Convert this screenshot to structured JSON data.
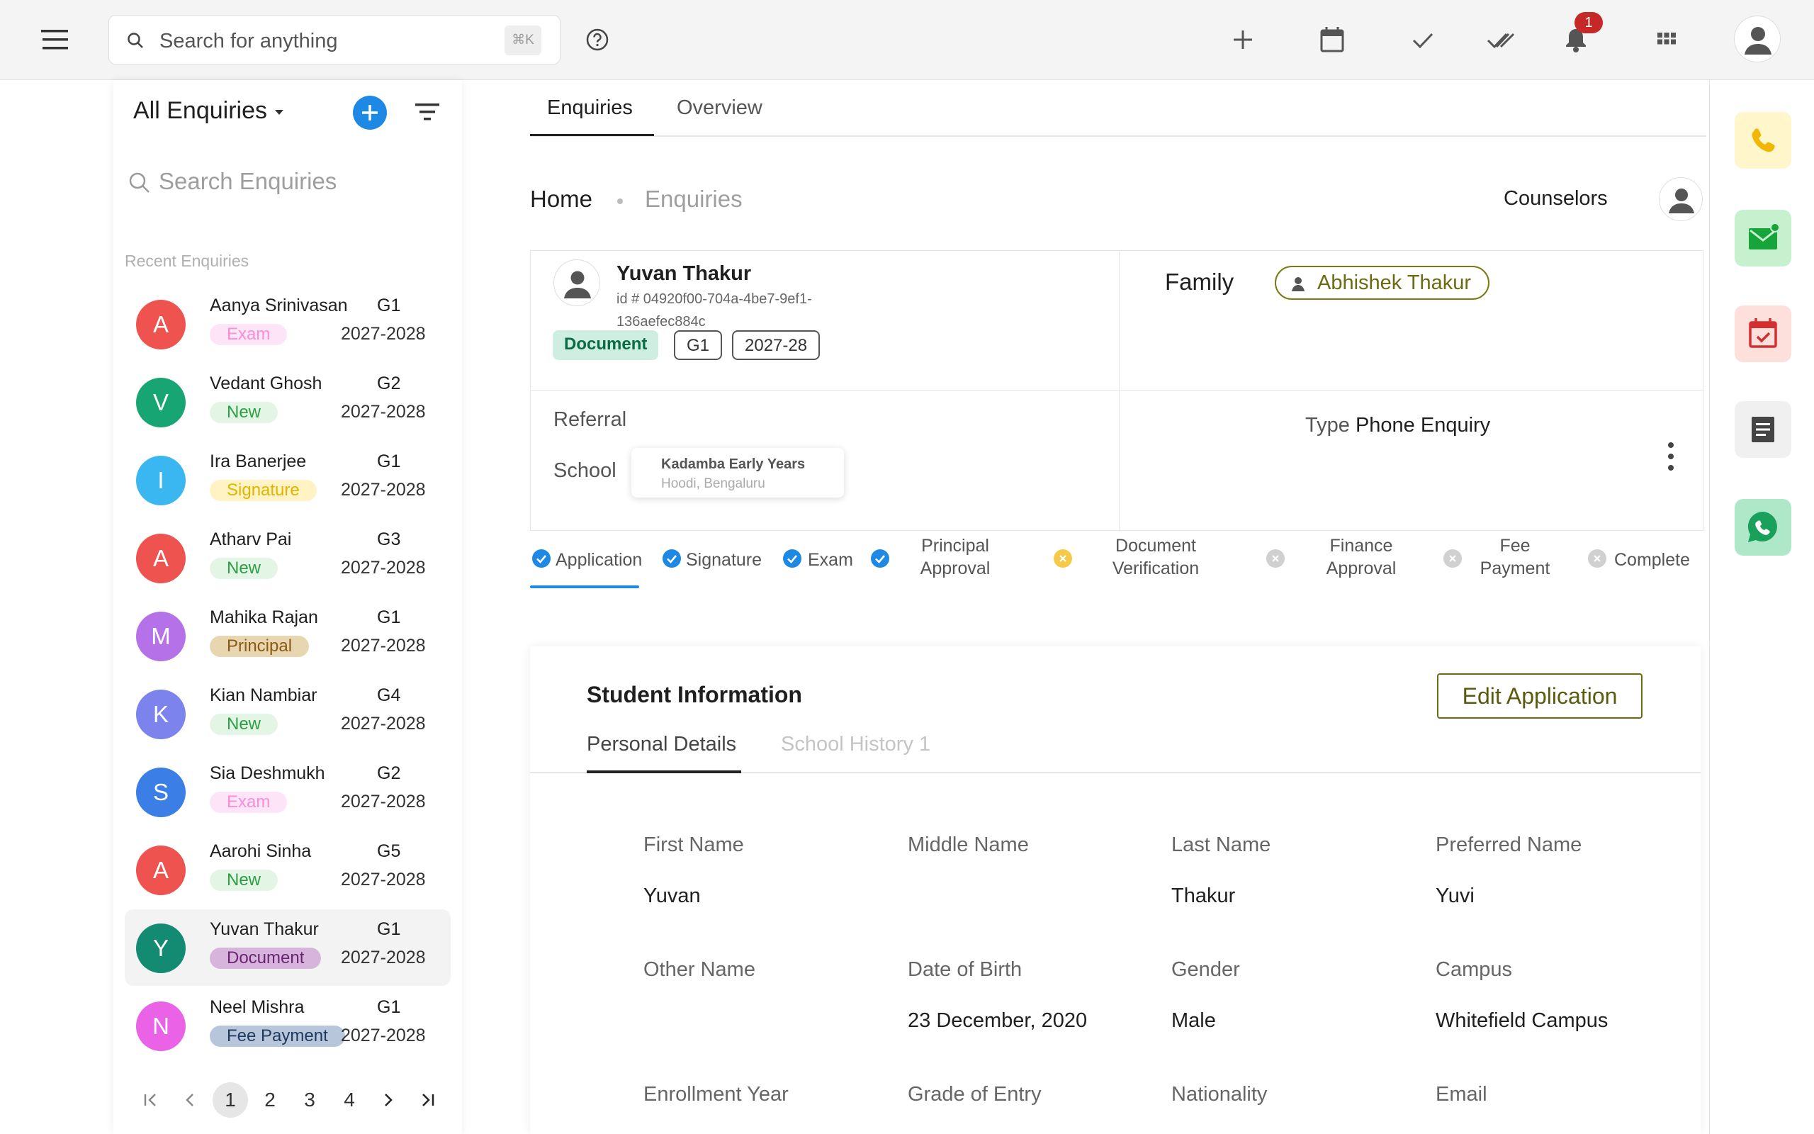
{
  "topbar": {
    "search_placeholder": "Search for anything",
    "search_shortcut": "⌘K",
    "notification_count": "1",
    "icons": [
      "menu-icon",
      "search-icon",
      "help-icon",
      "plus-icon",
      "calendar-icon",
      "check-icon",
      "double-check-icon",
      "bell-icon",
      "apps-grid-icon",
      "user-avatar-icon"
    ]
  },
  "sidebar": {
    "title": "All Enquiries",
    "search_placeholder": "Search Enquiries",
    "recent_label": "Recent Enquiries",
    "items": [
      {
        "initial": "A",
        "name": "Aanya Srinivasan",
        "grade": "G1",
        "status": "Exam",
        "year": "2027-2028",
        "avatar_color": "#ef5350",
        "tag_bg": "#fde4f6",
        "tag_fg": "#f48fd8"
      },
      {
        "initial": "V",
        "name": "Vedant Ghosh",
        "grade": "G2",
        "status": "New",
        "year": "2027-2028",
        "avatar_color": "#17a673",
        "tag_bg": "#e3f6e6",
        "tag_fg": "#2e9e45"
      },
      {
        "initial": "I",
        "name": "Ira Banerjee",
        "grade": "G1",
        "status": "Signature",
        "year": "2027-2028",
        "avatar_color": "#3ab7f0",
        "tag_bg": "#fff3c4",
        "tag_fg": "#e0b400"
      },
      {
        "initial": "A",
        "name": "Atharv Pai",
        "grade": "G3",
        "status": "New",
        "year": "2027-2028",
        "avatar_color": "#ef5350",
        "tag_bg": "#e3f6e6",
        "tag_fg": "#2e9e45"
      },
      {
        "initial": "M",
        "name": "Mahika Rajan",
        "grade": "G1",
        "status": "Principal",
        "year": "2027-2028",
        "avatar_color": "#b572e8",
        "tag_bg": "#e8d6b0",
        "tag_fg": "#8a5a14"
      },
      {
        "initial": "K",
        "name": "Kian Nambiar",
        "grade": "G4",
        "status": "New",
        "year": "2027-2028",
        "avatar_color": "#7c83ec",
        "tag_bg": "#e3f6e6",
        "tag_fg": "#2e9e45"
      },
      {
        "initial": "S",
        "name": "Sia Deshmukh",
        "grade": "G2",
        "status": "Exam",
        "year": "2027-2028",
        "avatar_color": "#3a7ee6",
        "tag_bg": "#fde4f6",
        "tag_fg": "#f48fd8"
      },
      {
        "initial": "A",
        "name": "Aarohi Sinha",
        "grade": "G5",
        "status": "New",
        "year": "2027-2028",
        "avatar_color": "#ef5350",
        "tag_bg": "#e3f6e6",
        "tag_fg": "#2e9e45"
      },
      {
        "initial": "Y",
        "name": "Yuvan Thakur",
        "grade": "G1",
        "status": "Document",
        "year": "2027-2028",
        "avatar_color": "#138a72",
        "tag_bg": "#d7b4dc",
        "tag_fg": "#6b2474"
      },
      {
        "initial": "N",
        "name": "Neel Mishra",
        "grade": "G1",
        "status": "Fee Payment",
        "year": "2027-2028",
        "avatar_color": "#ea62e6",
        "tag_bg": "#b7c6da",
        "tag_fg": "#1d3a5e"
      }
    ],
    "pagination": [
      "1",
      "2",
      "3",
      "4"
    ],
    "current_page": "1"
  },
  "main": {
    "tabs": [
      "Enquiries",
      "Overview"
    ],
    "breadcrumb": {
      "home": "Home",
      "current": "Enquiries"
    },
    "counselors_label": "Counselors",
    "student": {
      "name": "Yuvan Thakur",
      "id": "id # 04920f00-704a-4be7-9ef1-136aefec884c",
      "chips": [
        "Document",
        "G1",
        "2027-28"
      ]
    },
    "family": {
      "label": "Family",
      "member": "Abhishek Thakur"
    },
    "referral_label": "Referral",
    "school_label": "School",
    "school": {
      "name": "Kadamba Early Years",
      "location": "Hoodi, Bengaluru"
    },
    "type": {
      "label": "Type",
      "value": "Phone Enquiry"
    },
    "steps": [
      {
        "label": "Application",
        "state": "done"
      },
      {
        "label": "Signature",
        "state": "done"
      },
      {
        "label": "Exam",
        "state": "done"
      },
      {
        "label": "Principal Approval",
        "state": "done"
      },
      {
        "label": "Document Verification",
        "state": "current"
      },
      {
        "label": "Finance Approval",
        "state": "pending"
      },
      {
        "label": "Fee Payment",
        "state": "pending"
      },
      {
        "label": "Complete",
        "state": "pending"
      }
    ],
    "info": {
      "title": "Student Information",
      "edit_button": "Edit Application",
      "sub_tabs": [
        "Personal Details",
        "School History 1"
      ],
      "fields": [
        {
          "label": "First Name",
          "value": "Yuvan"
        },
        {
          "label": "Middle Name",
          "value": ""
        },
        {
          "label": "Last Name",
          "value": "Thakur"
        },
        {
          "label": "Preferred Name",
          "value": "Yuvi"
        },
        {
          "label": "Other Name",
          "value": ""
        },
        {
          "label": "Date of Birth",
          "value": "23 December, 2020"
        },
        {
          "label": "Gender",
          "value": "Male"
        },
        {
          "label": "Campus",
          "value": "Whitefield Campus"
        },
        {
          "label": "Enrollment Year",
          "value": ""
        },
        {
          "label": "Grade of Entry",
          "value": ""
        },
        {
          "label": "Nationality",
          "value": ""
        },
        {
          "label": "Email",
          "value": ""
        }
      ]
    }
  },
  "rail": {
    "buttons": [
      "phone-icon",
      "email-icon",
      "calendar-icon",
      "notes-icon",
      "whatsapp-icon"
    ]
  },
  "colors": {
    "accent_blue": "#1e88e5",
    "olive": "#6b6b12",
    "alert_red": "#c62828"
  }
}
